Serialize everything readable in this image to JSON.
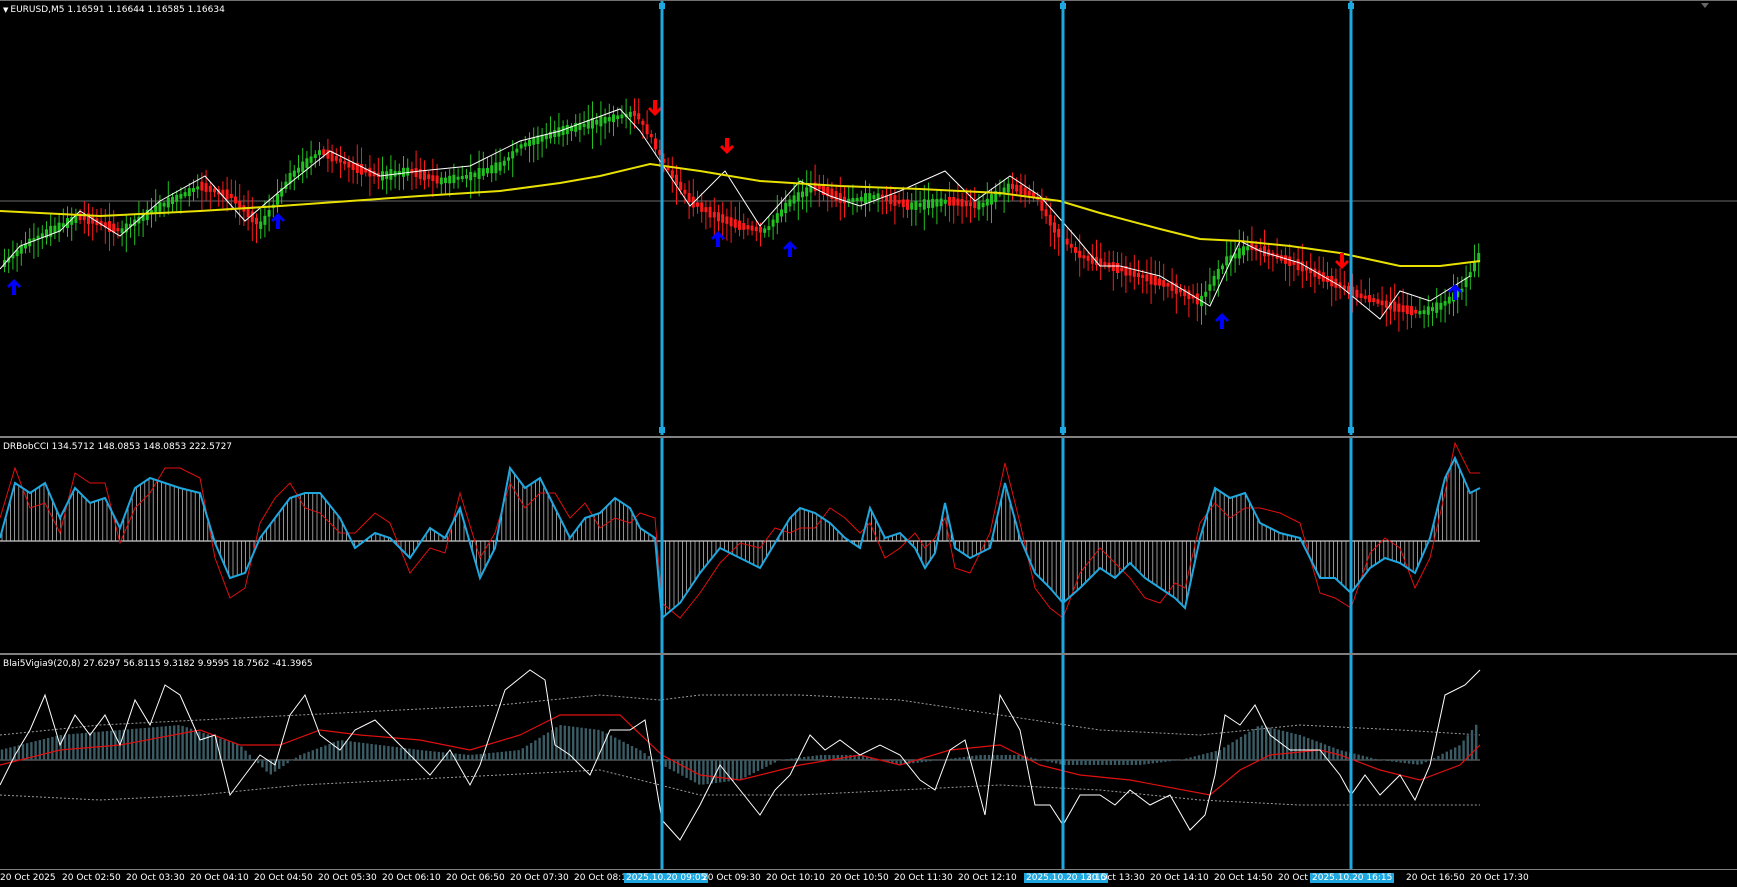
{
  "main_pane": {
    "title": "EURUSD,M5  1.16591 1.16644 1.16585 1.16634",
    "up_color": "#22c022",
    "down_color": "#ff1a1a",
    "ma_color": "#e8e000",
    "arrow_up_color": "#0000ff",
    "arrow_down_color": "#ff0000",
    "arrow_up_icon": "arrow-up-icon",
    "arrow_down_icon": "arrow-down-icon"
  },
  "cci_pane": {
    "title": "DRBobCCI 134.5712 148.0853 148.0853 222.5727",
    "cci_color": "#1fa8e0",
    "signal_color": "#e01010"
  },
  "osc_pane": {
    "title": "Blai5Vigia9(20,8) 27.6297 56.8115 9.3182 9.9595 18.7562 -41.3965",
    "line_color": "#ffffff",
    "signal_color": "#e01010",
    "hist_color": "#3a5a64",
    "band_color": "#9a9a9a"
  },
  "vline_color": "#1fa8e0",
  "time_axis": {
    "labels": [
      "20 Oct 2025",
      "20 Oct 02:50",
      "20 Oct 03:30",
      "20 Oct 04:10",
      "20 Oct 04:50",
      "20 Oct 05:30",
      "20 Oct 06:10",
      "20 Oct 06:50",
      "20 Oct 07:30",
      "20 Oct 08:1",
      "2025.10.20 09:05",
      "20 Oct 09:30",
      "20 Oct 10:10",
      "20 Oct 10:50",
      "20 Oct 11:30",
      "20 Oct 12:10",
      "2025.10.20 13:15",
      "20 Oct 13:30",
      "20 Oct 14:10",
      "20 Oct 14:50",
      "20 Oct 15:",
      "2025.10.20 16:15",
      "20 Oct 16:50",
      "20 Oct 17:30"
    ],
    "highlighted": [
      "2025.10.20 09:05",
      "2025.10.20 13:15",
      "2025.10.20 16:15"
    ]
  }
}
